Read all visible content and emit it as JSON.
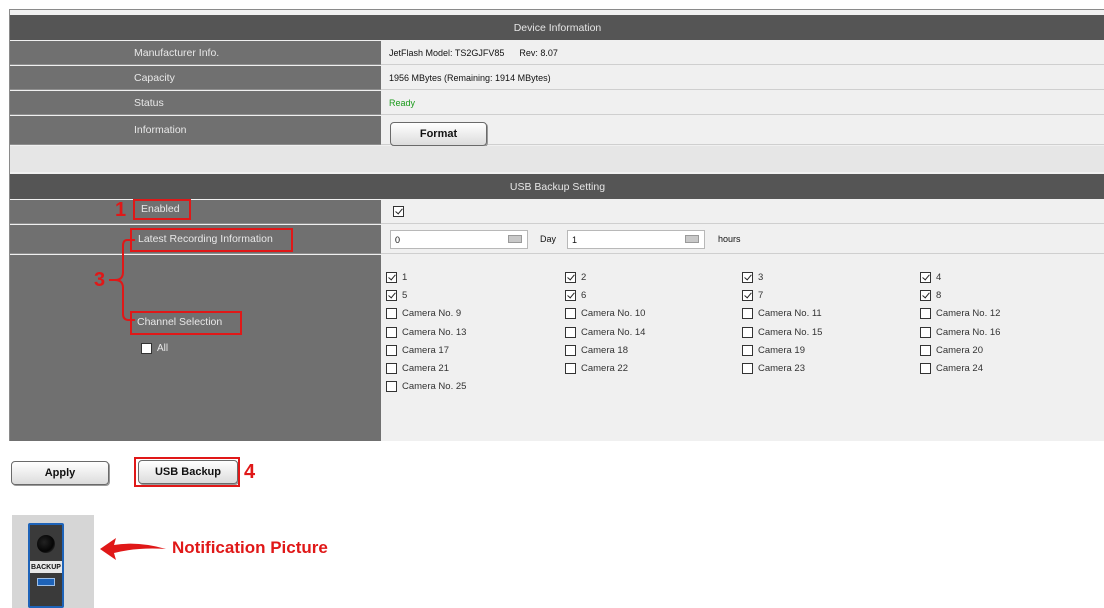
{
  "device_info": {
    "header": "Device Information",
    "rows": [
      {
        "label": "Manufacturer Info.",
        "value": "JetFlash Model: TS2GJFV85      Rev: 8.07"
      },
      {
        "label": "Capacity",
        "value": "1956 MBytes (Remaining: 1914 MBytes)"
      },
      {
        "label": "Status",
        "value": "Ready"
      },
      {
        "label": "Information",
        "value": ""
      }
    ],
    "format_button": "Format"
  },
  "usb_backup": {
    "header": "USB Backup Setting",
    "enabled_label": "Enabled",
    "enabled_checked": true,
    "latest_label": "Latest Recording Information",
    "day_value": "0",
    "day_unit": "Day",
    "hours_value": "1",
    "hours_unit": "hours",
    "channel_label": "Channel Selection",
    "all_label": "All",
    "all_checked": false,
    "channels": [
      {
        "label": "1",
        "checked": true
      },
      {
        "label": "2",
        "checked": true
      },
      {
        "label": "3",
        "checked": true
      },
      {
        "label": "4",
        "checked": true
      },
      {
        "label": "5",
        "checked": true
      },
      {
        "label": "6",
        "checked": true
      },
      {
        "label": "7",
        "checked": true
      },
      {
        "label": "8",
        "checked": true
      },
      {
        "label": "Camera No. 9",
        "checked": false
      },
      {
        "label": "Camera No. 10",
        "checked": false
      },
      {
        "label": "Camera No. 11",
        "checked": false
      },
      {
        "label": "Camera No. 12",
        "checked": false
      },
      {
        "label": "Camera No. 13",
        "checked": false
      },
      {
        "label": "Camera No. 14",
        "checked": false
      },
      {
        "label": "Camera No. 15",
        "checked": false
      },
      {
        "label": "Camera No. 16",
        "checked": false
      },
      {
        "label": "Camera 17",
        "checked": false
      },
      {
        "label": "Camera 18",
        "checked": false
      },
      {
        "label": "Camera 19",
        "checked": false
      },
      {
        "label": "Camera 20",
        "checked": false
      },
      {
        "label": "Camera 21",
        "checked": false
      },
      {
        "label": "Camera 22",
        "checked": false
      },
      {
        "label": "Camera 23",
        "checked": false
      },
      {
        "label": "Camera 24",
        "checked": false
      },
      {
        "label": "Camera No. 25",
        "checked": false
      }
    ]
  },
  "buttons": {
    "apply": "Apply",
    "usb_backup": "USB Backup"
  },
  "annotations": {
    "n1": "1",
    "n3": "3",
    "n4": "4",
    "notification": "Notification Picture",
    "backup_icon_text": "BACKUP"
  },
  "colors": {
    "header_bg": "#555555",
    "label_bg": "#707070",
    "annotation_red": "#e01818",
    "ready_green": "#1a9a1a"
  }
}
